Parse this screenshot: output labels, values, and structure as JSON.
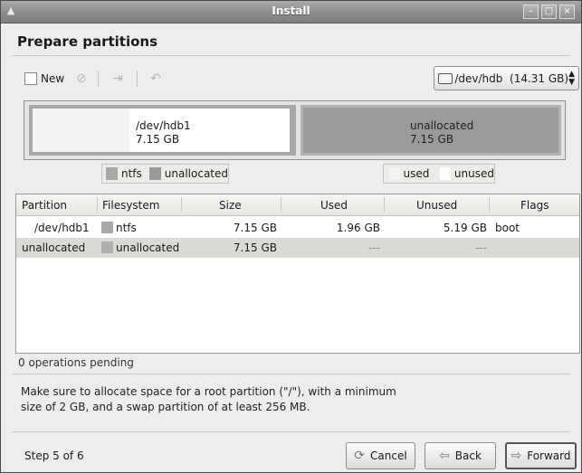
{
  "window": {
    "title": "Install",
    "controls": [
      "minimize-icon",
      "maximize-icon",
      "close-icon"
    ]
  },
  "page": {
    "heading": "Prepare partitions"
  },
  "toolbar": {
    "new_label": "New",
    "icons": [
      "delete-icon",
      "edit-icon",
      "undo-icon"
    ]
  },
  "disk_select": {
    "value": "/dev/hdb  (14.31 GB)"
  },
  "partition_bar": {
    "segments": [
      {
        "name": "/dev/hdb1",
        "size": "7.15 GB"
      },
      {
        "name": "unallocated",
        "size": "7.15 GB"
      }
    ]
  },
  "legend_fs": {
    "ntfs": "ntfs",
    "unallocated": "unallocated"
  },
  "legend_usage": {
    "used": "used",
    "unused": "unused"
  },
  "table": {
    "headers": [
      "Partition",
      "Filesystem",
      "Size",
      "Used",
      "Unused",
      "Flags"
    ],
    "rows": [
      {
        "partition": "/dev/hdb1",
        "filesystem": "ntfs",
        "size": "7.15 GB",
        "used": "1.96 GB",
        "unused": "5.19 GB",
        "flags": "boot"
      },
      {
        "partition": "unallocated",
        "filesystem": "unallocated",
        "size": "7.15 GB",
        "used": "---",
        "unused": "---",
        "flags": ""
      }
    ]
  },
  "status": {
    "operations": "0 operations pending",
    "hint": "Make sure to allocate space for a root partition (\"/\"), with a minimum size of 2 GB, and a swap partition of at least 256 MB."
  },
  "footer": {
    "step": "Step 5 of 6",
    "cancel": "Cancel",
    "back": "Back",
    "forward": "Forward"
  },
  "colors": {
    "ntfs": "#a8a8a8",
    "unallocated": "#9a9a9a",
    "selection": "#dadad7"
  }
}
